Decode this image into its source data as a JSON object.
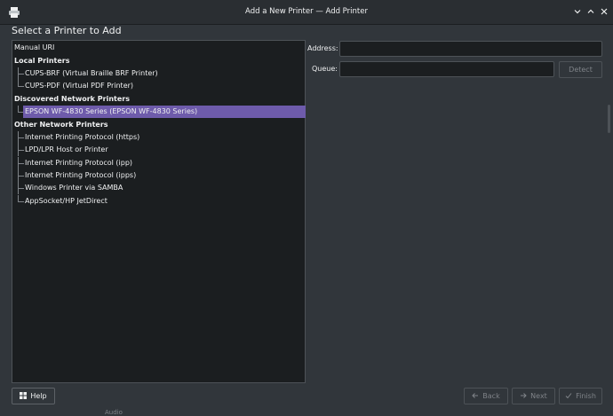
{
  "window": {
    "title": "Add a New Printer — Add Printer"
  },
  "heading": "Select a Printer to Add",
  "tree": {
    "items": [
      {
        "label": "Manual URI",
        "kind": "top"
      },
      {
        "label": "Local Printers",
        "kind": "header"
      },
      {
        "label": "CUPS-BRF (Virtual Braille BRF Printer)",
        "kind": "child"
      },
      {
        "label": "CUPS-PDF (Virtual PDF Printer)",
        "kind": "child-last"
      },
      {
        "label": "Discovered Network Printers",
        "kind": "header"
      },
      {
        "label": "EPSON WF-4830 Series (EPSON WF-4830 Series)",
        "kind": "child-last",
        "selected": true
      },
      {
        "label": "Other Network Printers",
        "kind": "header"
      },
      {
        "label": "Internet Printing Protocol (https)",
        "kind": "child"
      },
      {
        "label": "LPD/LPR Host or Printer",
        "kind": "child"
      },
      {
        "label": "Internet Printing Protocol (ipp)",
        "kind": "child"
      },
      {
        "label": "Internet Printing Protocol (ipps)",
        "kind": "child"
      },
      {
        "label": "Windows Printer via SAMBA",
        "kind": "child"
      },
      {
        "label": "AppSocket/HP JetDirect",
        "kind": "child-last"
      }
    ]
  },
  "form": {
    "address_label": "Address:",
    "address_value": "",
    "queue_label": "Queue:",
    "queue_value": "",
    "detect_label": "Detect"
  },
  "buttons": {
    "help": "Help",
    "back": "Back",
    "next": "Next",
    "finish": "Finish"
  },
  "background_text": "Audio",
  "colors": {
    "selection": "#6e5bab",
    "background": "#31363b",
    "field": "#1b1e20"
  }
}
